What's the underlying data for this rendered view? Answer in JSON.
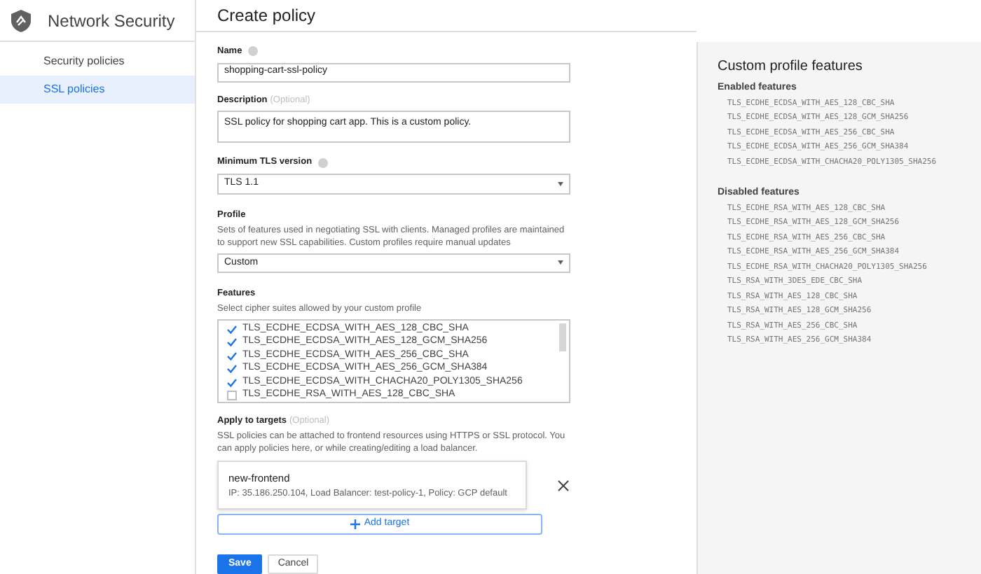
{
  "app": {
    "title": "Network Security"
  },
  "sidebar": {
    "items": [
      {
        "label": "Security policies",
        "selected": false
      },
      {
        "label": "SSL policies",
        "selected": true
      }
    ]
  },
  "page": {
    "title": "Create policy"
  },
  "form": {
    "name": {
      "label": "Name",
      "value": "shopping-cart-ssl-policy"
    },
    "description": {
      "label": "Description",
      "optional": "(Optional)",
      "value": "SSL policy for shopping cart app. This is a custom policy."
    },
    "min_tls": {
      "label": "Minimum TLS version",
      "value": "TLS 1.1"
    },
    "profile": {
      "label": "Profile",
      "help": "Sets of features used in negotiating SSL with clients. Managed profiles are maintained to support new SSL capabilities. Custom profiles require manual updates",
      "value": "Custom"
    },
    "features": {
      "label": "Features",
      "help": "Select cipher suites allowed by your custom profile",
      "items": [
        {
          "label": "TLS_ECDHE_ECDSA_WITH_AES_128_CBC_SHA",
          "checked": true
        },
        {
          "label": "TLS_ECDHE_ECDSA_WITH_AES_128_GCM_SHA256",
          "checked": true
        },
        {
          "label": "TLS_ECDHE_ECDSA_WITH_AES_256_CBC_SHA",
          "checked": true
        },
        {
          "label": "TLS_ECDHE_ECDSA_WITH_AES_256_GCM_SHA384",
          "checked": true
        },
        {
          "label": "TLS_ECDHE_ECDSA_WITH_CHACHA20_POLY1305_SHA256",
          "checked": true
        },
        {
          "label": "TLS_ECDHE_RSA_WITH_AES_128_CBC_SHA",
          "checked": false
        }
      ]
    },
    "targets": {
      "label": "Apply to targets",
      "optional": "(Optional)",
      "help": "SSL policies can be attached to frontend resources using HTTPS or SSL protocol. You can apply policies here, or while creating/editing a load balancer.",
      "items": [
        {
          "name": "new-frontend",
          "details": "IP: 35.186.250.104, Load Balancer: test-policy-1, Policy: GCP default"
        }
      ],
      "add_button": "Add target"
    },
    "buttons": [
      "Save",
      "Cancel"
    ]
  },
  "panel": {
    "title": "Custom profile features",
    "enabled": {
      "heading": "Enabled features",
      "items": [
        "TLS_ECDHE_ECDSA_WITH_AES_128_CBC_SHA",
        "TLS_ECDHE_ECDSA_WITH_AES_128_GCM_SHA256",
        "TLS_ECDHE_ECDSA_WITH_AES_256_CBC_SHA",
        "TLS_ECDHE_ECDSA_WITH_AES_256_GCM_SHA384",
        "TLS_ECDHE_ECDSA_WITH_CHACHA20_POLY1305_SHA256"
      ]
    },
    "disabled": {
      "heading": "Disabled features",
      "items": [
        "TLS_ECDHE_RSA_WITH_AES_128_CBC_SHA",
        "TLS_ECDHE_RSA_WITH_AES_128_GCM_SHA256",
        "TLS_ECDHE_RSA_WITH_AES_256_CBC_SHA",
        "TLS_ECDHE_RSA_WITH_AES_256_GCM_SHA384",
        "TLS_ECDHE_RSA_WITH_CHACHA20_POLY1305_SHA256",
        "TLS_RSA_WITH_3DES_EDE_CBC_SHA",
        "TLS_RSA_WITH_AES_128_CBC_SHA",
        "TLS_RSA_WITH_AES_128_GCM_SHA256",
        "TLS_RSA_WITH_AES_256_CBC_SHA",
        "TLS_RSA_WITH_AES_256_GCM_SHA384"
      ]
    }
  }
}
